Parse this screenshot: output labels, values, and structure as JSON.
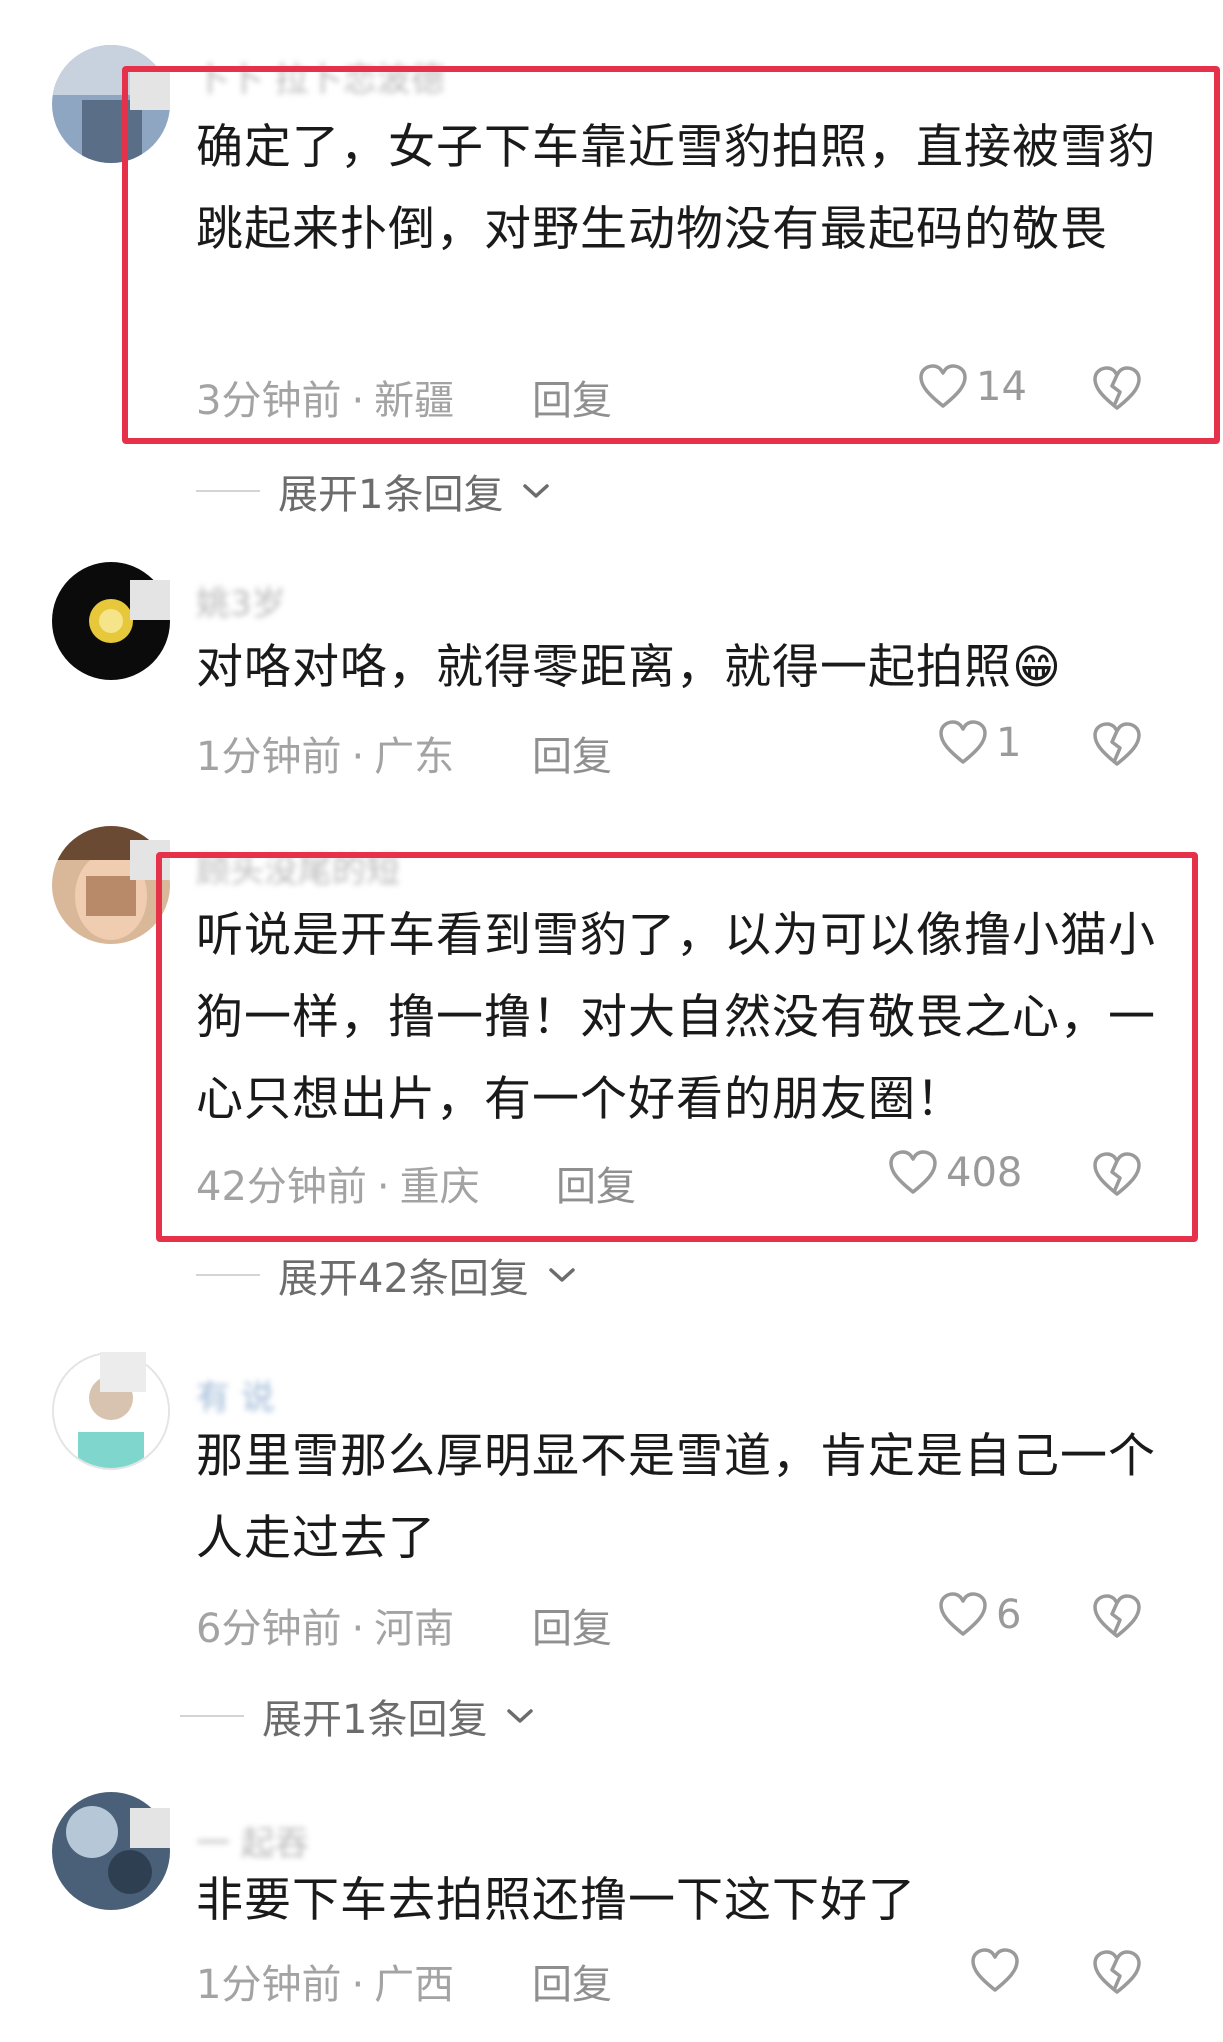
{
  "colors": {
    "highlight": "#e5324a",
    "meta": "#a3a3a3",
    "text": "#1a1a1a"
  },
  "comments": [
    {
      "username": "卜卜 拉卜恋波德",
      "text": "确定了，女子下车靠近雪豹拍照，直接被雪豹跳起来扑倒，对野生动物没有最起码的敬畏",
      "time": "3分钟前",
      "location": "新疆",
      "reply": "回复",
      "likes": "14",
      "expand": "展开1条回复"
    },
    {
      "username": "姚3岁",
      "text": "对咯对咯，就得零距离，就得一起拍照😁",
      "time": "1分钟前",
      "location": "广东",
      "reply": "回复",
      "likes": "1"
    },
    {
      "username": "顾头没尾的短",
      "text": "听说是开车看到雪豹了，以为可以像撸小猫小狗一样，撸一撸！对大自然没有敬畏之心，一心只想出片，有一个好看的朋友圈！",
      "time": "42分钟前",
      "location": "重庆",
      "reply": "回复",
      "likes": "408",
      "expand": "展开42条回复"
    },
    {
      "username": "有 说",
      "text": "那里雪那么厚明显不是雪道，肯定是自己一个人走过去了",
      "time": "6分钟前",
      "location": "河南",
      "reply": "回复",
      "likes": "6",
      "expand": "展开1条回复"
    },
    {
      "username": "一 起吞",
      "text": "非要下车去拍照还撸一下这下好了",
      "time": "1分钟前",
      "location": "广西",
      "reply": "回复",
      "likes": ""
    }
  ],
  "meta_separator": "·"
}
